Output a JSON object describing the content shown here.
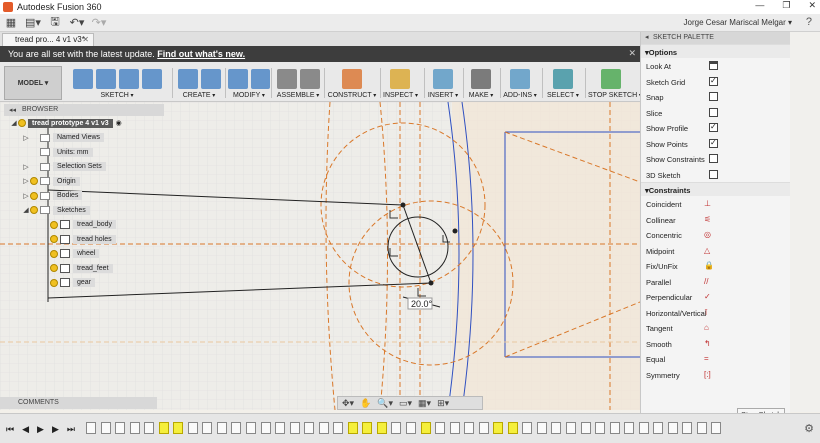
{
  "window": {
    "title": "Autodesk Fusion 360",
    "min": "—",
    "max": "❐",
    "close": "✕"
  },
  "qat": {
    "user": "Jorge Cesar Mariscal Melgar ▾",
    "help": "?"
  },
  "tab": {
    "label": "tread pro... 4 v1 v3*",
    "close": "✕"
  },
  "banner": {
    "text": "You are all set with the latest update.",
    "link": "Find out what's new.",
    "close": "✕"
  },
  "toolbar": {
    "mode": "MODEL ▾",
    "groups": [
      {
        "label": "SKETCH",
        "color": "#3a7ac0"
      },
      {
        "label": "CREATE",
        "color": "#3a7ac0"
      },
      {
        "label": "MODIFY",
        "color": "#3a7ac0"
      },
      {
        "label": "ASSEMBLE",
        "color": "#6a6a6a"
      },
      {
        "label": "CONSTRUCT",
        "color": "#d86a20"
      },
      {
        "label": "INSPECT",
        "color": "#d8a020"
      },
      {
        "label": "INSERT",
        "color": "#4a90c0"
      },
      {
        "label": "MAKE",
        "color": "#555555"
      },
      {
        "label": "ADD-INS",
        "color": "#4a90c0"
      },
      {
        "label": "SELECT",
        "color": "#2a8a9a"
      },
      {
        "label": "STOP SKETCH",
        "color": "#3aa040"
      }
    ]
  },
  "browser": {
    "header": "BROWSER",
    "root": "tread prototype 4 v1 v3",
    "items": [
      {
        "label": "Named Views"
      },
      {
        "label": "Units: mm"
      },
      {
        "label": "Selection Sets"
      },
      {
        "label": "Origin"
      },
      {
        "label": "Bodies"
      },
      {
        "label": "Sketches"
      },
      {
        "label": "tread_body"
      },
      {
        "label": "tread holes"
      },
      {
        "label": "wheel"
      },
      {
        "label": "tread_feet"
      },
      {
        "label": "gear"
      }
    ]
  },
  "comments": "COMMENTS",
  "dimension": "20.0°",
  "palette": {
    "header": "SKETCH PALETTE",
    "options_title": "Options",
    "options": [
      {
        "label": "Look At",
        "checked": null
      },
      {
        "label": "Sketch Grid",
        "checked": true
      },
      {
        "label": "Snap",
        "checked": false
      },
      {
        "label": "Slice",
        "checked": false
      },
      {
        "label": "Show Profile",
        "checked": true
      },
      {
        "label": "Show Points",
        "checked": true
      },
      {
        "label": "Show Constraints",
        "checked": false
      },
      {
        "label": "3D Sketch",
        "checked": false
      }
    ],
    "constraints_title": "Constraints",
    "constraints": [
      {
        "label": "Coincident",
        "icon": "coincident-icon"
      },
      {
        "label": "Collinear",
        "icon": "collinear-icon"
      },
      {
        "label": "Concentric",
        "icon": "concentric-icon"
      },
      {
        "label": "Midpoint",
        "icon": "midpoint-icon"
      },
      {
        "label": "Fix/UnFix",
        "icon": "lock-icon"
      },
      {
        "label": "Parallel",
        "icon": "parallel-icon"
      },
      {
        "label": "Perpendicular",
        "icon": "perpendicular-icon"
      },
      {
        "label": "Horizontal/Vertical",
        "icon": "horizontal-vertical-icon"
      },
      {
        "label": "Tangent",
        "icon": "tangent-icon"
      },
      {
        "label": "Smooth",
        "icon": "smooth-icon"
      },
      {
        "label": "Equal",
        "icon": "equal-icon"
      },
      {
        "label": "Symmetry",
        "icon": "symmetry-icon"
      }
    ],
    "stop": "Stop Sketch"
  },
  "timeline": {
    "controls": [
      "⏮",
      "◀",
      "▶",
      "▶",
      "⏭"
    ],
    "marks": 44,
    "highlighted": [
      5,
      6,
      18,
      19,
      20,
      23,
      28,
      29
    ]
  }
}
